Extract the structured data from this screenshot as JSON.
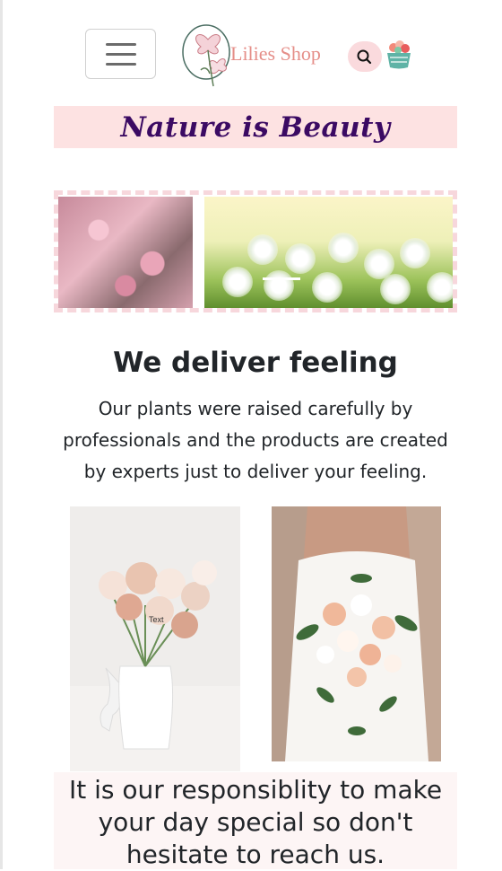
{
  "navbar": {
    "brand": "Lilies Shop",
    "menu_icon": "hamburger-icon",
    "search_icon": "search-icon",
    "cart_icon": "basket-icon",
    "logo_icon": "lily-logo-icon"
  },
  "banner": {
    "slogan": "Nature is Beauty"
  },
  "carousel": {
    "slides": [
      "cherry-blossom-image",
      "dandelion-field-image"
    ]
  },
  "about": {
    "heading": "We deliver feeling",
    "text": "Our plants were raised carefully by professionals and the products are created by experts just to deliver your feeling."
  },
  "gallery": {
    "vase_caption": "Text"
  },
  "closing": {
    "text": "It is our responsiblity to make your day special so don't hesitate to reach us."
  },
  "colors": {
    "brand_pink": "#e58e88",
    "slogan_bg": "#fde2e2",
    "slogan_text": "#3b0a63",
    "search_bg": "#fadadd"
  }
}
